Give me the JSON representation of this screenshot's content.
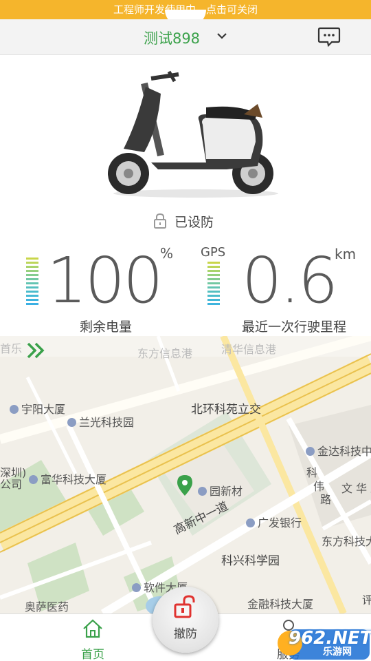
{
  "dev_banner": "工程师开发使用中，点击可关闭",
  "header": {
    "device_name": "测试898"
  },
  "status": {
    "lock_label": "已设防"
  },
  "battery": {
    "value": "100",
    "unit": "%",
    "label": "剩余电量",
    "level": 1.0
  },
  "distance": {
    "gps_label": "GPS",
    "value": "0.6",
    "unit": "km",
    "label": "最近一次行驶里程"
  },
  "map": {
    "labels": [
      "东方信息港",
      "清华信息港",
      "宇阳大厦",
      "兰光科技园",
      "北环科苑立交",
      "金达科技中心",
      "富华科技大厦",
      "园新材",
      "科",
      "伟",
      "路",
      "文 华 路",
      "高新中一道",
      "广发银行",
      "东方科技大厦",
      "科兴科学园",
      "软件大厦",
      "奥萨医药",
      "金融科技大厦",
      "深圳)",
      "公司",
      "首乐",
      "评"
    ]
  },
  "tabbar": {
    "home_label": "首页",
    "service_label": "服务",
    "disarm_label": "撤防"
  },
  "watermark": {
    "text": "962.NET",
    "sub": "乐游网"
  },
  "colors": {
    "accent": "#3aa14a",
    "banner": "#f5b52c",
    "disarm": "#e0322f"
  }
}
